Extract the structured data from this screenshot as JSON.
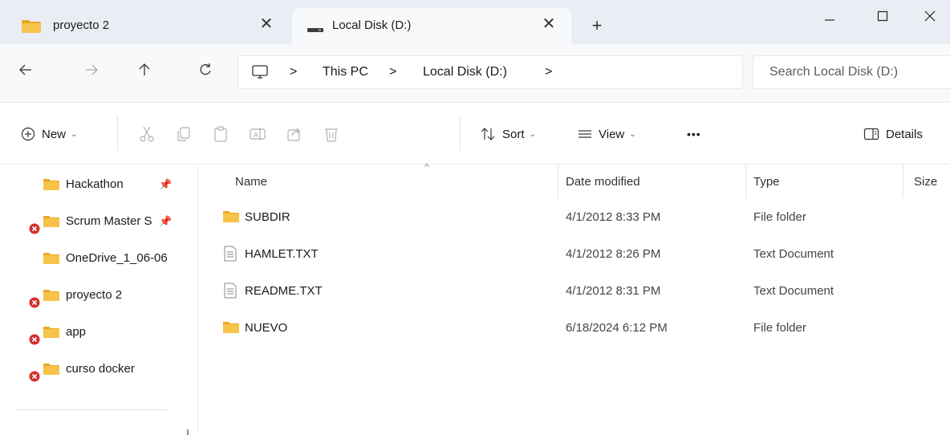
{
  "tabs": [
    {
      "label": "proyecto 2",
      "icon": "folder-icon",
      "active": false
    },
    {
      "label": "Local Disk (D:)",
      "icon": "drive-icon",
      "active": true
    }
  ],
  "new_tab_glyph": "+",
  "close_glyph": "✕",
  "address": {
    "crumbs": [
      "This PC",
      "Local Disk (D:)"
    ],
    "separator": ">",
    "search_placeholder": "Search Local Disk (D:)"
  },
  "commands": {
    "new_label": "New",
    "sort_label": "Sort",
    "view_label": "View",
    "more_label": "•••",
    "details_label": "Details"
  },
  "sidebar": {
    "items": [
      {
        "label": "Hackathon",
        "pinned": true,
        "error": false
      },
      {
        "label": "Scrum Master S",
        "pinned": true,
        "error": true
      },
      {
        "label": "OneDrive_1_06-06",
        "pinned": false,
        "error": false
      },
      {
        "label": "proyecto 2",
        "pinned": false,
        "error": true
      },
      {
        "label": "app",
        "pinned": false,
        "error": true
      },
      {
        "label": "curso docker",
        "pinned": false,
        "error": true
      }
    ]
  },
  "filelist": {
    "columns": {
      "name": "Name",
      "date": "Date modified",
      "type": "Type",
      "size": "Size"
    },
    "rows": [
      {
        "name": "SUBDIR",
        "date": "4/1/2012 8:33 PM",
        "type": "File folder",
        "icon": "folder-icon"
      },
      {
        "name": "HAMLET.TXT",
        "date": "4/1/2012 8:26 PM",
        "type": "Text Document",
        "icon": "text-file-icon"
      },
      {
        "name": "README.TXT",
        "date": "4/1/2012 8:31 PM",
        "type": "Text Document",
        "icon": "text-file-icon"
      },
      {
        "name": "NUEVO",
        "date": "6/18/2024 6:12 PM",
        "type": "File folder",
        "icon": "folder-icon"
      }
    ]
  },
  "colors": {
    "folder": "#f7c34a",
    "error": "#d32f2f",
    "titlebar": "#e9edf4",
    "accent": "#1b1b1b"
  }
}
